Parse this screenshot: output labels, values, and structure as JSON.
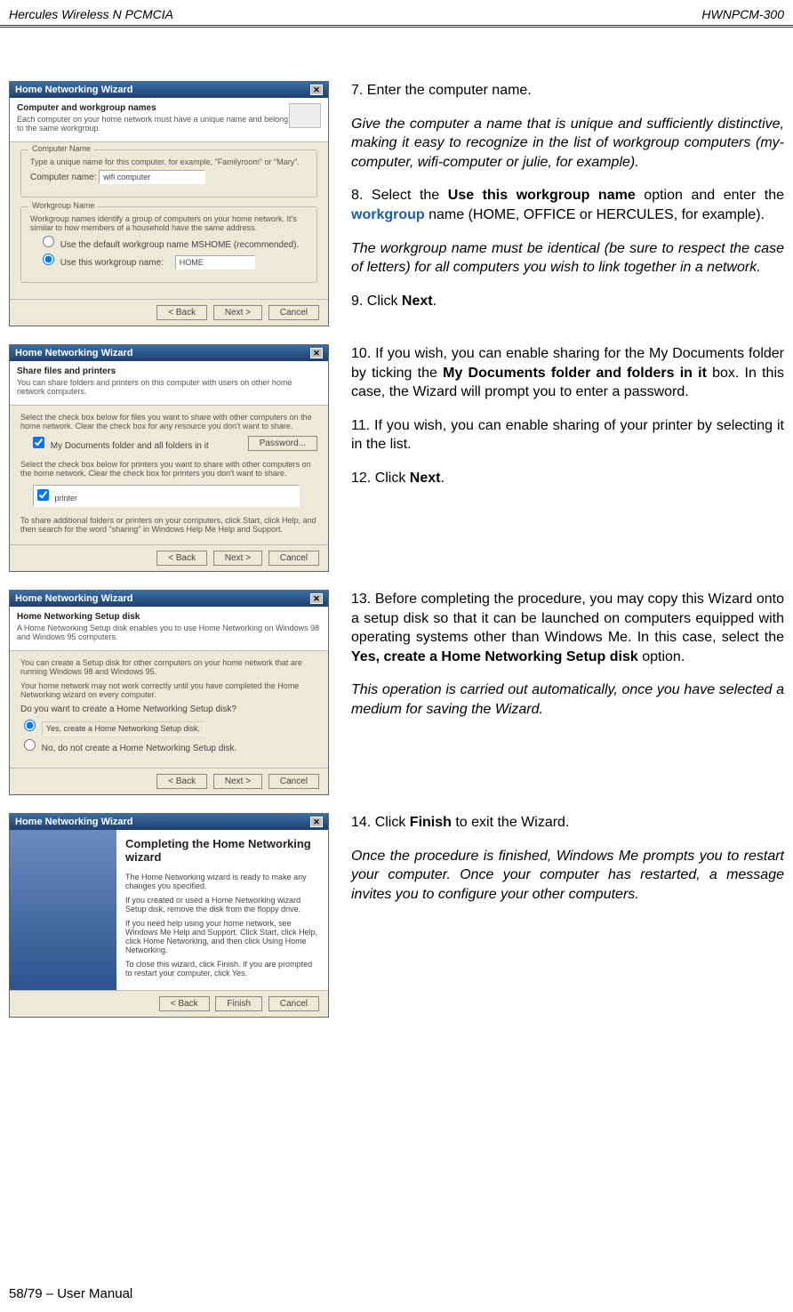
{
  "header": {
    "left": "Hercules Wireless N PCMCIA",
    "right": "HWNPCM-300"
  },
  "footer": "58/79 – User Manual",
  "wiz_title": "Home Networking Wizard",
  "wiz1": {
    "hdr_t": "Computer and workgroup names",
    "hdr_s": "Each computer on your home network must have a unique name and belong to the same workgroup.",
    "grp1_legend": "Computer Name",
    "grp1_desc": "Type a unique name for this computer, for example, \"Familyroom\" or \"Mary\".",
    "lbl_comp": "Computer name:",
    "val_comp": "wifi computer",
    "grp2_legend": "Workgroup Name",
    "grp2_desc": "Workgroup names identify a group of computers on your home network. It's similar to how members of a household have the same address.",
    "r1": "Use the default workgroup name MSHOME (recommended).",
    "r2": "Use this workgroup name:",
    "val_wg": "HOME"
  },
  "wiz2": {
    "hdr_t": "Share files and printers",
    "hdr_s": "You can share folders and printers on this computer with users on other home network computers.",
    "p1": "Select the check box below for files you want to share with other computers on the home network. Clear the check box for any resource you don't want to share.",
    "chk1": "My Documents folder and all folders in it",
    "btn_pw": "Password...",
    "p2": "Select the check box below for printers you want to share with other computers on the home network. Clear the check box for printers you don't want to share.",
    "chk2": "printer",
    "p3": "To share additional folders or printers on your computers, click Start, click Help, and then search for the word \"sharing\" in Windows Help Me Help and Support."
  },
  "wiz3": {
    "hdr_t": "Home Networking Setup disk",
    "hdr_s": "A Home Networking Setup disk enables you to use Home Networking on Windows 98 and Windows 95 computers.",
    "p1": "You can create a Setup disk for other computers on your home network that are running Windows 98 and Windows 95.",
    "p2": "Your home network may not work correctly until you have completed the Home Networking wizard on every computer.",
    "q": "Do you want to create a Home Networking Setup disk?",
    "r1": "Yes, create a Home Networking Setup disk.",
    "r2": "No, do not create a Home Networking Setup disk."
  },
  "wiz4": {
    "title": "Completing the Home Networking wizard",
    "p1": "The Home Networking wizard is ready to make any changes you specified.",
    "p2": "If you created or used a Home Networking wizard Setup disk, remove the disk from the floppy drive.",
    "p3": "If you need help using your home network, see Windows Me Help and Support. Click Start, click Help, click Home Networking, and then click Using Home Networking.",
    "p4": "To close this wizard, click Finish.  If you are prompted to restart your computer, click Yes."
  },
  "btns": {
    "back": "< Back",
    "next": "Next >",
    "cancel": "Cancel",
    "finish": "Finish"
  },
  "text": {
    "s7": "7.   Enter the computer name.",
    "s7i": "Give the computer a name that is unique and sufficiently distinctive, making it easy to recognize in the list of workgroup computers (my-computer, wifi-computer or julie, for example).",
    "s8a": "8.   Select the ",
    "s8b": "Use this workgroup name",
    "s8c": " option and enter the ",
    "s8d": "workgroup",
    "s8e": " name (HOME, OFFICE or HERCULES, for example).",
    "s8i": "The workgroup name must be identical (be sure to respect the case of letters) for all computers you wish to link together in a network.",
    "s9a": "9.   Click ",
    "s9b": "Next",
    "s9c": ".",
    "s10a": "10. If you wish, you can enable sharing for the My Documents folder by ticking the ",
    "s10b": "My Documents folder and folders in it",
    "s10c": " box.  In this case, the Wizard will prompt you to enter a password.",
    "s11": "11. If you wish, you can enable sharing of your printer by selecting it in the list.",
    "s12a": "12. Click ",
    "s12b": "Next",
    "s12c": ".",
    "s13a": "13. Before completing the procedure, you may copy this Wizard onto a setup disk so that it can be launched on computers equipped with operating systems other than Windows Me.  In this case, select the ",
    "s13b": "Yes, create a Home Networking Setup disk",
    "s13c": " option.",
    "s13i": "This operation is carried out automatically, once you have selected a medium for saving the Wizard.",
    "s14a": "14. Click ",
    "s14b": "Finish",
    "s14c": " to exit the Wizard.",
    "s14i": "Once the procedure is finished, Windows Me prompts you to restart your computer.  Once your computer has restarted, a message invites you to configure your other computers."
  }
}
